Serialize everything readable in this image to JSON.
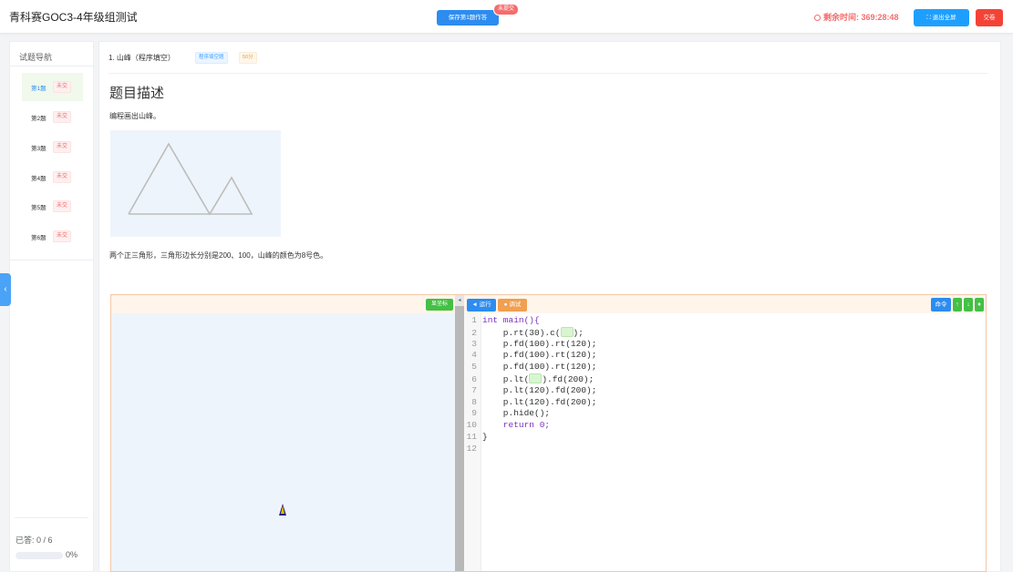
{
  "header": {
    "title": "青科赛GOC3-4年级组测试",
    "save_button": "保存第1题作答",
    "unsubmitted_badge": "未提交",
    "timer_label": "剩余时间:",
    "timer_value": "369:28:48",
    "fullscreen_button": "退出全屏",
    "submit_button": "交卷"
  },
  "sidebar": {
    "title": "试题导航",
    "items": [
      {
        "label": "第1题",
        "status": "未交"
      },
      {
        "label": "第2题",
        "status": "未交"
      },
      {
        "label": "第3题",
        "status": "未交"
      },
      {
        "label": "第4题",
        "status": "未交"
      },
      {
        "label": "第5题",
        "status": "未交"
      },
      {
        "label": "第6题",
        "status": "未交"
      }
    ],
    "answered_label": "已答: 0 / 6",
    "progress_percent": "0%",
    "progress_value": 0
  },
  "question": {
    "title": "1. 山峰（程序填空）",
    "type_tag": "程序填空题",
    "score_tag": "50分",
    "desc_heading": "题目描述",
    "desc_text": "编程画出山峰。",
    "detail_text": "两个正三角形，三角形边长分别是200、100，山峰的颜色为8号色。"
  },
  "workspace": {
    "show_coords_button": "显坐标",
    "run_button": "◄ 运行",
    "debug_button": "● 调试",
    "command_button": "命令",
    "small_buttons": [
      "↑",
      "↓",
      "♦"
    ]
  },
  "code": {
    "line_numbers": [
      "1",
      "2",
      "3",
      "4",
      "5",
      "6",
      "7",
      "8",
      "9",
      "10",
      "11",
      "12"
    ],
    "lines": [
      "int main(){",
      "    p.rt(30).c(",
      "    p.fd(100).rt(120);",
      "    p.fd(100).rt(120);",
      "    p.fd(100).rt(120);",
      "    p.lt(",
      "    p.lt(120).fd(200);",
      "    p.lt(120).fd(200);",
      "    p.hide();",
      "    return 0;",
      "}",
      ""
    ],
    "line2_suffix": ");",
    "line6_suffix": ").fd(200);"
  },
  "colors": {
    "primary": "#2d8cf0",
    "danger": "#f44336",
    "success": "#44c044",
    "warning": "#f0a050"
  }
}
